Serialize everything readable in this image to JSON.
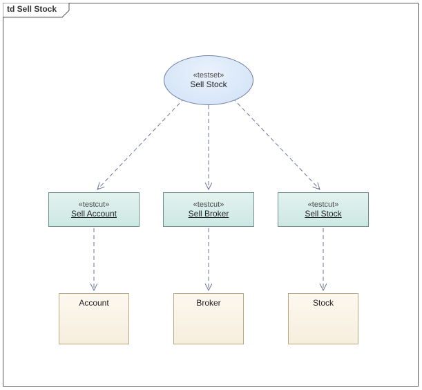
{
  "frame": {
    "title": "td Sell Stock"
  },
  "testset": {
    "stereotype": "«testset»",
    "name": "Sell Stock"
  },
  "testcuts": [
    {
      "stereotype": "«testcut»",
      "name": "Sell Account"
    },
    {
      "stereotype": "«testcut»",
      "name": "Sell Broker"
    },
    {
      "stereotype": "«testcut»",
      "name": "Sell Stock"
    }
  ],
  "classes": [
    {
      "name": "Account"
    },
    {
      "name": "Broker"
    },
    {
      "name": "Stock"
    }
  ]
}
